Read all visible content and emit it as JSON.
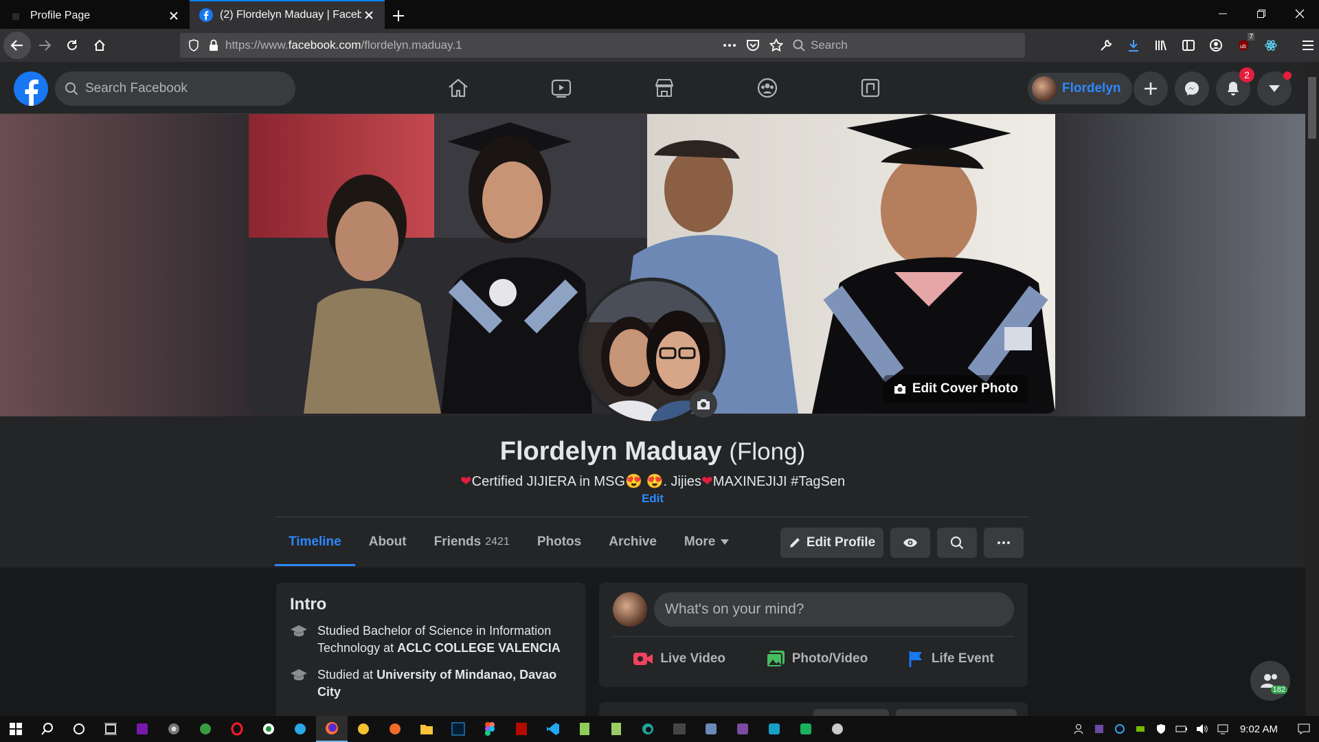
{
  "browser": {
    "tabs": [
      {
        "title": "Profile Page",
        "active": false
      },
      {
        "title": "(2) Flordelyn Maduay | Faceboo",
        "active": true
      }
    ],
    "url_prefix": "https://www.",
    "url_domain": "facebook.com",
    "url_path": "/flordelyn.maduay.1",
    "search_placeholder": "Search",
    "extension_badge": "7"
  },
  "fb": {
    "search_placeholder": "Search Facebook",
    "nav_icons": [
      "home-icon",
      "watch-icon",
      "marketplace-icon",
      "groups-icon",
      "gaming-icon"
    ],
    "profile_chip_name": "Flordelyn",
    "notifications_count": "2"
  },
  "profile": {
    "name": "Flordelyn Maduay",
    "nickname": "(Flong)",
    "bio_part1": "Certified JIJIERA in MSG",
    "bio_part2": ". Jijies",
    "bio_part3": "MAXINEJIJI #TagSen",
    "bio_emoji": "😍 😍",
    "bio_edit": "Edit",
    "edit_cover_label": "Edit Cover Photo",
    "tabs": [
      {
        "label": "Timeline",
        "count": ""
      },
      {
        "label": "About",
        "count": ""
      },
      {
        "label": "Friends",
        "count": "2421"
      },
      {
        "label": "Photos",
        "count": ""
      },
      {
        "label": "Archive",
        "count": ""
      },
      {
        "label": "More",
        "count": ""
      }
    ],
    "edit_profile_label": "Edit Profile"
  },
  "intro": {
    "title": "Intro",
    "items": [
      {
        "prefix": "Studied Bachelor of Science in Information Technology at ",
        "bold": "ACLC COLLEGE VALENCIA"
      },
      {
        "prefix": "Studied at ",
        "bold": "University of Mindanao, Davao City"
      }
    ]
  },
  "composer": {
    "placeholder": "What's on your mind?",
    "actions": [
      {
        "label": "Live Video",
        "color": "#f3425f"
      },
      {
        "label": "Photo/Video",
        "color": "#45bd62"
      },
      {
        "label": "Life Event",
        "color": "#1877f2"
      }
    ]
  },
  "contacts_count": "182",
  "taskbar": {
    "clock": "9:02 AM"
  },
  "colors": {
    "accent": "#2d88ff",
    "fb_blue": "#1877f2",
    "background": "#18191a",
    "card": "#242526"
  }
}
